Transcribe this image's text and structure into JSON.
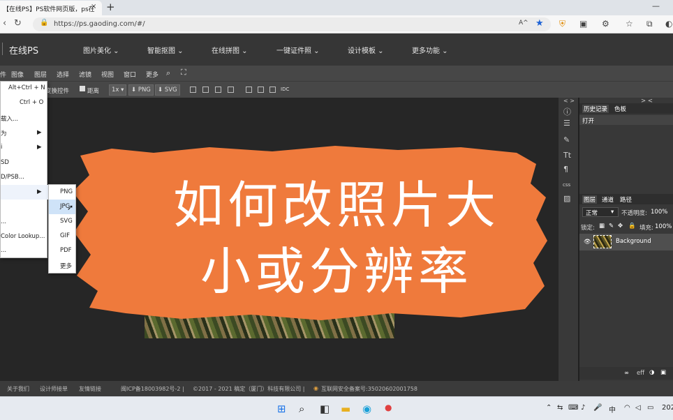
{
  "browser": {
    "tab_title": "【在线PS】PS软件网页版，ps在",
    "tab_close": "×",
    "new_tab": "+",
    "url": "https://ps.gaoding.com/#/",
    "win_min": "—",
    "reader_icon": "Aᴬ"
  },
  "app": {
    "brand": "在线PS",
    "nav": [
      "图片美化 ⌄",
      "智能抠图 ⌄",
      "在线拼图 ⌄",
      "一键证件照 ⌄",
      "设计模板 ⌄",
      "更多功能 ⌄"
    ]
  },
  "menubar": {
    "items": [
      "件",
      "图像",
      "图层",
      "选择",
      "滤镜",
      "视图",
      "窗口",
      "更多"
    ]
  },
  "options": {
    "transform": "变换控件",
    "distance": "距离",
    "zoom": "1x",
    "png": "PNG",
    "svg": "SVG",
    "idc": "IDC"
  },
  "file_menu": {
    "items": [
      {
        "label": "",
        "shortcut": "Alt+Ctrl + N"
      },
      {
        "label": "",
        "shortcut": "Ctrl + O"
      },
      {
        "label": "载入...",
        "shortcut": ""
      },
      {
        "label": "为",
        "shortcut": "▶"
      },
      {
        "label": "i",
        "shortcut": "▶"
      },
      {
        "label": "SD",
        "shortcut": ""
      },
      {
        "label": "D/PSB...",
        "shortcut": ""
      },
      {
        "label": "",
        "shortcut": "▶"
      },
      {
        "label": "",
        "shortcut": ""
      },
      {
        "label": "...",
        "shortcut": ""
      },
      {
        "label": "Color Lookup...",
        "shortcut": ""
      },
      {
        "label": "...",
        "shortcut": ""
      }
    ]
  },
  "export_menu": {
    "items": [
      "PNG",
      "JPG",
      "SVG",
      "GIF",
      "PDF",
      "更多"
    ],
    "highlighted_index": 1
  },
  "overlay": {
    "line1": "如何改照片大",
    "line2": "小或分辨率",
    "brush_color": "#ef7a3c"
  },
  "panels": {
    "history_tab": "历史记录",
    "swatches_tab": "色板",
    "history_item": "打开",
    "layers_tab": "图层",
    "channels_tab": "通道",
    "paths_tab": "路径",
    "blend_mode": "正常",
    "opacity_label": "不透明度:",
    "opacity_value": "100%",
    "lock_label": "锁定:",
    "fill_label": "填充:",
    "fill_value": "100%",
    "layer_name": "Background",
    "collapse_left": "< >",
    "collapse_right": "> <",
    "footer_eff": "eff"
  },
  "rightstrip": {
    "text_tool": "Tt",
    "paragraph": "¶",
    "css": "css"
  },
  "footer": {
    "about": "关于我们",
    "design": "设计师接单",
    "links": "友情链接",
    "icp": "闽ICP备18003982号-2  |",
    "copyright": "©2017 - 2021 稿定（厦门）科技有限公司  |",
    "police": "互联网安全备案号:35020602001758"
  },
  "taskbar": {
    "ime": "中",
    "clock": "202"
  }
}
